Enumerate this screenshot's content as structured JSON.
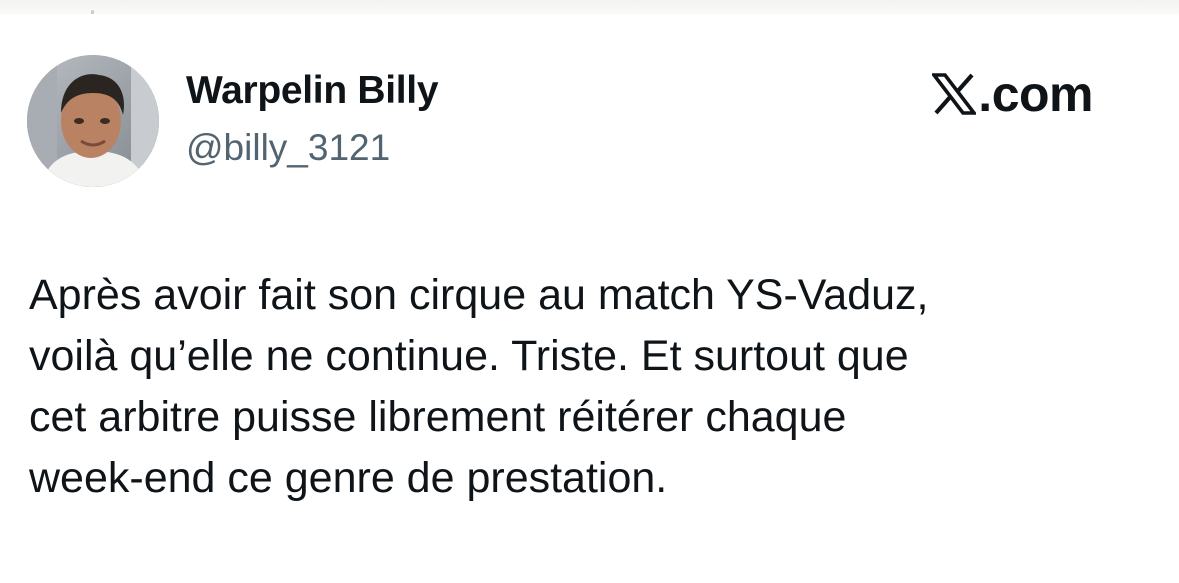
{
  "author": {
    "display_name": "Warpelin Billy",
    "handle": "@billy_3121"
  },
  "brand": {
    "icon": "x-logo-icon",
    "text": ".com"
  },
  "tweet": {
    "lines": [
      "Après avoir fait son cirque au match YS-Vaduz,",
      "voilà qu’elle ne continue. Triste. Et surtout que",
      "cet arbitre puisse librement réitérer chaque",
      "week-end ce genre de prestation."
    ]
  },
  "colors": {
    "text": "#0f1419",
    "handle": "#536471",
    "background": "#ffffff"
  }
}
